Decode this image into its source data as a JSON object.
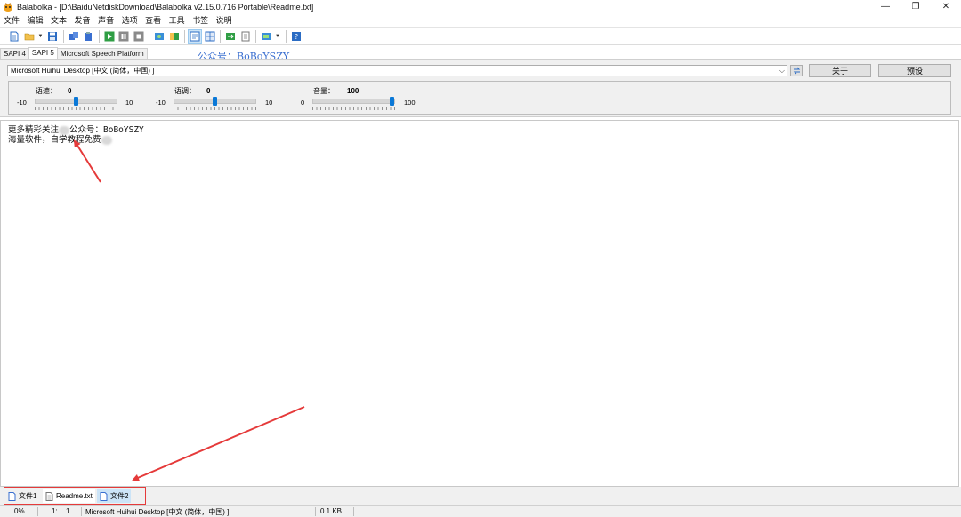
{
  "window": {
    "title": "Balabolka - [D:\\BaiduNetdiskDownload\\Balabolka v2.15.0.716 Portable\\Readme.txt]",
    "minimize_glyph": "—",
    "restore_glyph": "❐",
    "close_glyph": "✕"
  },
  "menu": [
    "文件",
    "编辑",
    "文本",
    "发音",
    "声音",
    "选项",
    "查看",
    "工具",
    "书签",
    "说明"
  ],
  "engine_tabs": [
    "SAPI 4",
    "SAPI 5",
    "Microsoft Speech Platform"
  ],
  "watermark_top": "公众号：BoBoYSZY",
  "voice": {
    "selected": "Microsoft Huihui Desktop [中文 (简体，中国) ]",
    "about_label": "关于",
    "presets_label": "预设"
  },
  "sliders": {
    "rate": {
      "label": "语速：",
      "value": "0",
      "min": "-10",
      "max": "10",
      "level": 0.5
    },
    "pitch": {
      "label": "语调：",
      "value": "0",
      "min": "-10",
      "max": "10",
      "level": 0.5
    },
    "volume": {
      "label": "音量：",
      "value": "100",
      "min": "0",
      "max": "100",
      "level": 1.0
    }
  },
  "editor": {
    "line1_a": "更多精彩关注",
    "line1_b": "公众号：BoBoYSZY",
    "line2": "海量软件，自学教程免费"
  },
  "doc_tabs": [
    "文件1",
    "Readme.txt",
    "文件2"
  ],
  "status": {
    "progress": "0%",
    "line": "1:",
    "col": "1",
    "voice": "Microsoft Huihui Desktop [中文 (简体，中国) ]",
    "size": "0.1 KB"
  },
  "colors": {
    "accent": "#0a78d7",
    "annotation": "#e53a3a",
    "watermark": "#3a6fd0"
  }
}
